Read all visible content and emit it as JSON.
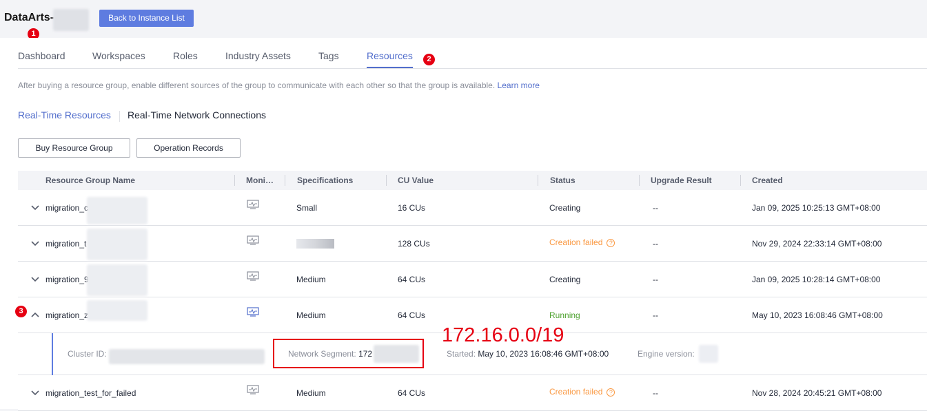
{
  "header": {
    "title": "DataArts-",
    "back_button": "Back to Instance List"
  },
  "markers": {
    "m1": "1",
    "m2": "2",
    "m3": "3"
  },
  "tabs": [
    {
      "label": "Dashboard"
    },
    {
      "label": "Workspaces"
    },
    {
      "label": "Roles"
    },
    {
      "label": "Industry Assets"
    },
    {
      "label": "Tags"
    },
    {
      "label": "Resources"
    }
  ],
  "hint": {
    "text": "After buying a resource group, enable different sources of the group to communicate with each other so that the group is available.",
    "link": "Learn more"
  },
  "subtabs": {
    "realtime_resources": "Real-Time Resources",
    "realtime_network": "Real-Time Network Connections"
  },
  "buttons": {
    "buy": "Buy Resource Group",
    "records": "Operation Records"
  },
  "table": {
    "headers": {
      "name": "Resource Group Name",
      "monitor": "Moni…",
      "spec": "Specifications",
      "cu": "CU Value",
      "status": "Status",
      "upgrade": "Upgrade Result",
      "created": "Created"
    },
    "rows": [
      {
        "name": "migration_c",
        "spec": "Small",
        "cu": "16 CUs",
        "status": "Creating",
        "upgrade": "--",
        "created": "Jan 09, 2025 10:25:13 GMT+08:00"
      },
      {
        "name": "migration_t",
        "spec": "",
        "cu": "128 CUs",
        "status": "Creation failed",
        "upgrade": "--",
        "created": "Nov 29, 2024 22:33:14 GMT+08:00"
      },
      {
        "name": "migration_9",
        "spec": "Medium",
        "cu": "64 CUs",
        "status": "Creating",
        "upgrade": "--",
        "created": "Jan 09, 2025 10:28:14 GMT+08:00"
      },
      {
        "name": "migration_z",
        "spec": "Medium",
        "cu": "64 CUs",
        "status": "Running",
        "upgrade": "--",
        "created": "May 10, 2023 16:08:46 GMT+08:00"
      },
      {
        "name": "migration_test_for_failed",
        "spec": "Medium",
        "cu": "64 CUs",
        "status": "Creation failed",
        "upgrade": "--",
        "created": "Nov 28, 2024 20:45:21 GMT+08:00"
      }
    ],
    "detail": {
      "cluster_label": "Cluster ID:",
      "segment_label": "Network Segment:",
      "segment_value": "172",
      "started_label": "Started:",
      "started_value": "May 10, 2023 16:08:46 GMT+08:00",
      "engine_label": "Engine version:"
    }
  },
  "annotation": "172.16.0.0/19",
  "colors": {
    "accent": "#526ecc",
    "failed": "#fa9841",
    "running": "#50a332",
    "marker": "#e60012"
  }
}
